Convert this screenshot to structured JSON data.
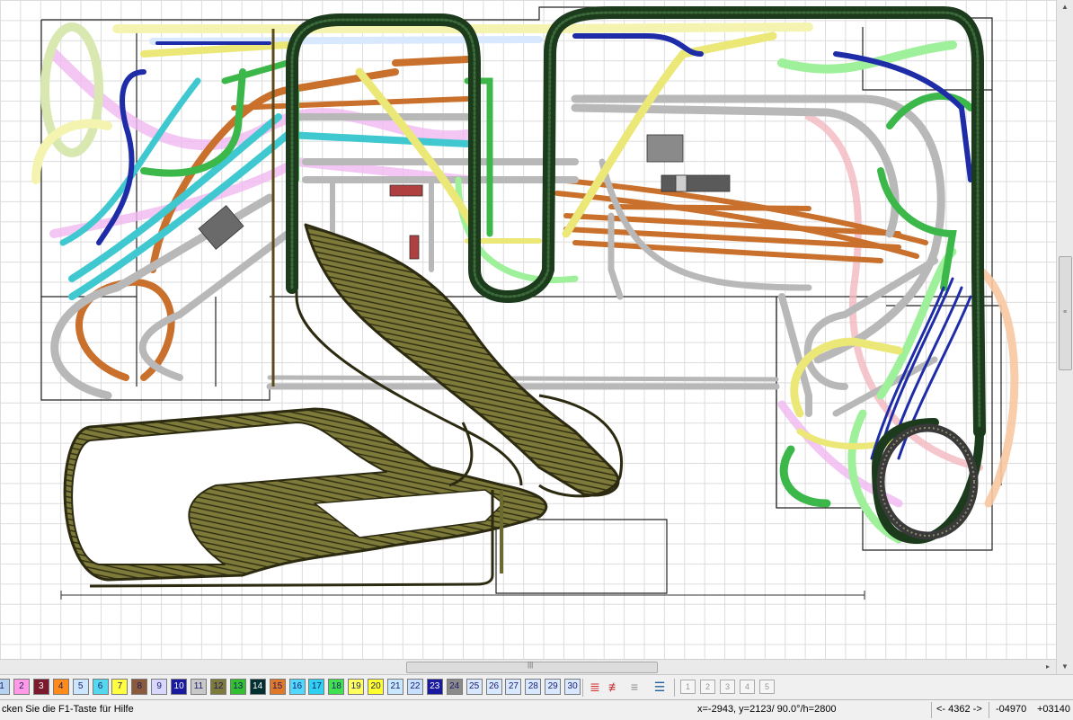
{
  "layer_colors": {
    "1": "#b5d3f0",
    "2": "#ff9be6",
    "3": "#7a1a2c",
    "4": "#ff8c1a",
    "5": "#cde6ff",
    "6": "#55d8ee",
    "7": "#ffff40",
    "8": "#8a5a3a",
    "9": "#d8d8ff",
    "10": "#1a1aa0",
    "11": "#c8c8c8",
    "12": "#7d7a3a",
    "13": "#30c030",
    "14": "#003030",
    "15": "#e07828",
    "16": "#50d8ff",
    "17": "#30d0f0",
    "18": "#40e050",
    "19": "#ffff60",
    "20": "#ffff30",
    "21": "#c8e8ff",
    "22": "#c8e0ff",
    "23": "#1a1aa0",
    "24": "#8a8a8a",
    "25": "#d8e8ff",
    "26": "#d8e8ff",
    "27": "#d8e8ff",
    "28": "#d8e8ff",
    "29": "#d8e8ff",
    "30": "#d8e8ff"
  },
  "layer_labels": {
    "1": "1",
    "2": "2",
    "3": "3",
    "4": "4",
    "5": "5",
    "6": "6",
    "7": "7",
    "8": "8",
    "9": "9",
    "10": "10",
    "11": "11",
    "12": "12",
    "13": "13",
    "14": "14",
    "15": "15",
    "16": "16",
    "17": "17",
    "18": "18",
    "19": "19",
    "20": "20",
    "21": "21",
    "22": "22",
    "23": "23",
    "24": "24",
    "25": "25",
    "26": "26",
    "27": "27",
    "28": "28",
    "29": "29",
    "30": "30"
  },
  "tool_icons": {
    "layers": "layers-icon",
    "hide": "hide-layers-icon",
    "dim": "dim-layers-icon",
    "stack": "layer-stack-icon"
  },
  "view_buttons": {
    "1": "1",
    "2": "2",
    "3": "3",
    "4": "4",
    "5": "5"
  },
  "status": {
    "help_text": "cken Sie die  F1-Taste für Hilfe",
    "coords": "x=-2943, y=2123/ 90.0°/h=2800",
    "range": "<- 4362 ->",
    "offset_x": "-04970",
    "offset_y": "+03140"
  },
  "scrollbar": {
    "grip": "|||"
  },
  "track_colors": {
    "dark_green": "#1c3a1c",
    "olive": "#6b6a2e",
    "olive_fill": "#7d7a3a",
    "gray": "#b8b8b8",
    "brown": "#c8702c",
    "yellow": "#ece878",
    "green": "#3cb84a",
    "light_green": "#9ef09a",
    "blue": "#1e2ca8",
    "cyan": "#40c8d0",
    "pink": "#f0b8f0",
    "peach": "#f8c8a0",
    "light_yellow": "#f4f4b0"
  }
}
